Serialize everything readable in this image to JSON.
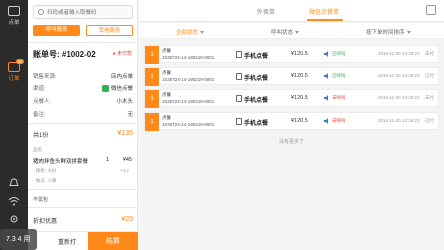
{
  "nav": {
    "items": [
      {
        "label": "点单"
      },
      {
        "label": "订单",
        "badge": "36"
      }
    ]
  },
  "panel": {
    "search_placeholder": "扫码或者输入取餐码",
    "call_btn": "呼叫服务",
    "other_btn": "其他服务",
    "order_title": "账单号: #1002-02",
    "order_status": "● 未付款",
    "info": [
      {
        "label": "销售来源:",
        "value": "店内点单"
      },
      {
        "label": "渠道:",
        "value": "微信点餐"
      },
      {
        "label": "点餐人:",
        "value": "小木头"
      },
      {
        "label": "备注:",
        "value": "无"
      }
    ],
    "summary_label": "共1份",
    "summary_amount": "¥135",
    "item_header": "品名",
    "item_name": "猪肉拌鱼头鲜双拼套餐",
    "item_qty": "1",
    "item_price": "¥45",
    "item_sub": "- 规格: 大份",
    "item_sub2": "+4.2",
    "item_sub3": "- 做法: 少辣",
    "pack": "不需包",
    "discount_label": "折扣优惠",
    "discount_amount": "¥20",
    "reprint": "重新打",
    "checkout": "结算",
    "toast": "7.3 4 用"
  },
  "main": {
    "tabs": [
      {
        "label": "外卖单"
      },
      {
        "label": "微信点餐单"
      }
    ],
    "filters": [
      {
        "label": "全部状态"
      },
      {
        "label": "呼叫状态"
      },
      {
        "label": "按下单时间排序"
      }
    ],
    "orders": [
      {
        "num": "1",
        "l1": "点餐",
        "l2": "JS30724-14-190219-0001",
        "type": "手机点餐",
        "price": "¥120.5",
        "status": "已呼叫",
        "status_color": "#2bb24c",
        "time": "2016-11-30 13:26:23",
        "tag": "未付"
      },
      {
        "num": "1",
        "l1": "点餐",
        "l2": "JS30724-14-190219-0001",
        "type": "手机点餐",
        "price": "¥120.5",
        "status": "已呼叫",
        "status_color": "#2bb24c",
        "time": "2016-11-30 13:26:23",
        "tag": "已付"
      },
      {
        "num": "1",
        "l1": "点餐",
        "l2": "JS30724-14-190219-0001",
        "type": "手机点餐",
        "price": "¥120.5",
        "status": "未呼叫",
        "status_color": "#e0443a",
        "time": "2016-11-30 13:26:23",
        "tag": "未付"
      },
      {
        "num": "1",
        "l1": "点餐",
        "l2": "JS30724-14-190219-0001",
        "type": "手机点餐",
        "price": "¥120.5",
        "status": "未呼叫",
        "status_color": "#e0443a",
        "time": "2016-11-30 13:26:23",
        "tag": "已付"
      }
    ],
    "no_more": "没有更多了"
  },
  "colors": {
    "accent": "#ff8a1a",
    "green": "#2bb24c",
    "red": "#e0443a"
  }
}
